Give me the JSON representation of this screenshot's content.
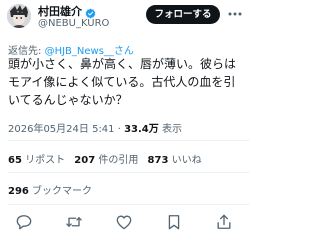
{
  "author": {
    "name": "村田雄介",
    "handle": "@NEBU_KURO",
    "avatar_icon": "user-avatar",
    "verified_icon": "verified-badge-icon"
  },
  "follow_button": {
    "label": "フォローする"
  },
  "more_icon": "more-icon",
  "reply": {
    "prefix": "返信先: ",
    "mention": "@HJB_News__さん"
  },
  "post": {
    "text": "頭が小さく、鼻が高く、唇が薄い。彼らはモアイ像によく似ている。古代人の血を引いてるんじゃないか？"
  },
  "meta": {
    "time": "2026年05月24日 5:41",
    "separator": " · ",
    "views_count": "33.4万",
    "views_label": " 表示"
  },
  "stats": {
    "reposts_count": "65",
    "reposts_label": " リポスト",
    "quotes_count": "207",
    "quotes_label": " 件の引用",
    "likes_count": "873",
    "likes_label": " いいね",
    "bookmarks_count": "296",
    "bookmarks_label": " ブックマーク"
  },
  "actions": [
    "reply-icon",
    "repost-icon",
    "like-icon",
    "bookmark-icon",
    "share-icon"
  ],
  "colors": {
    "link": "#1d9bf0",
    "text": "#0f1419",
    "secondary": "#536471",
    "verified": "#1d9bf0",
    "divider": "#eff3f4"
  }
}
